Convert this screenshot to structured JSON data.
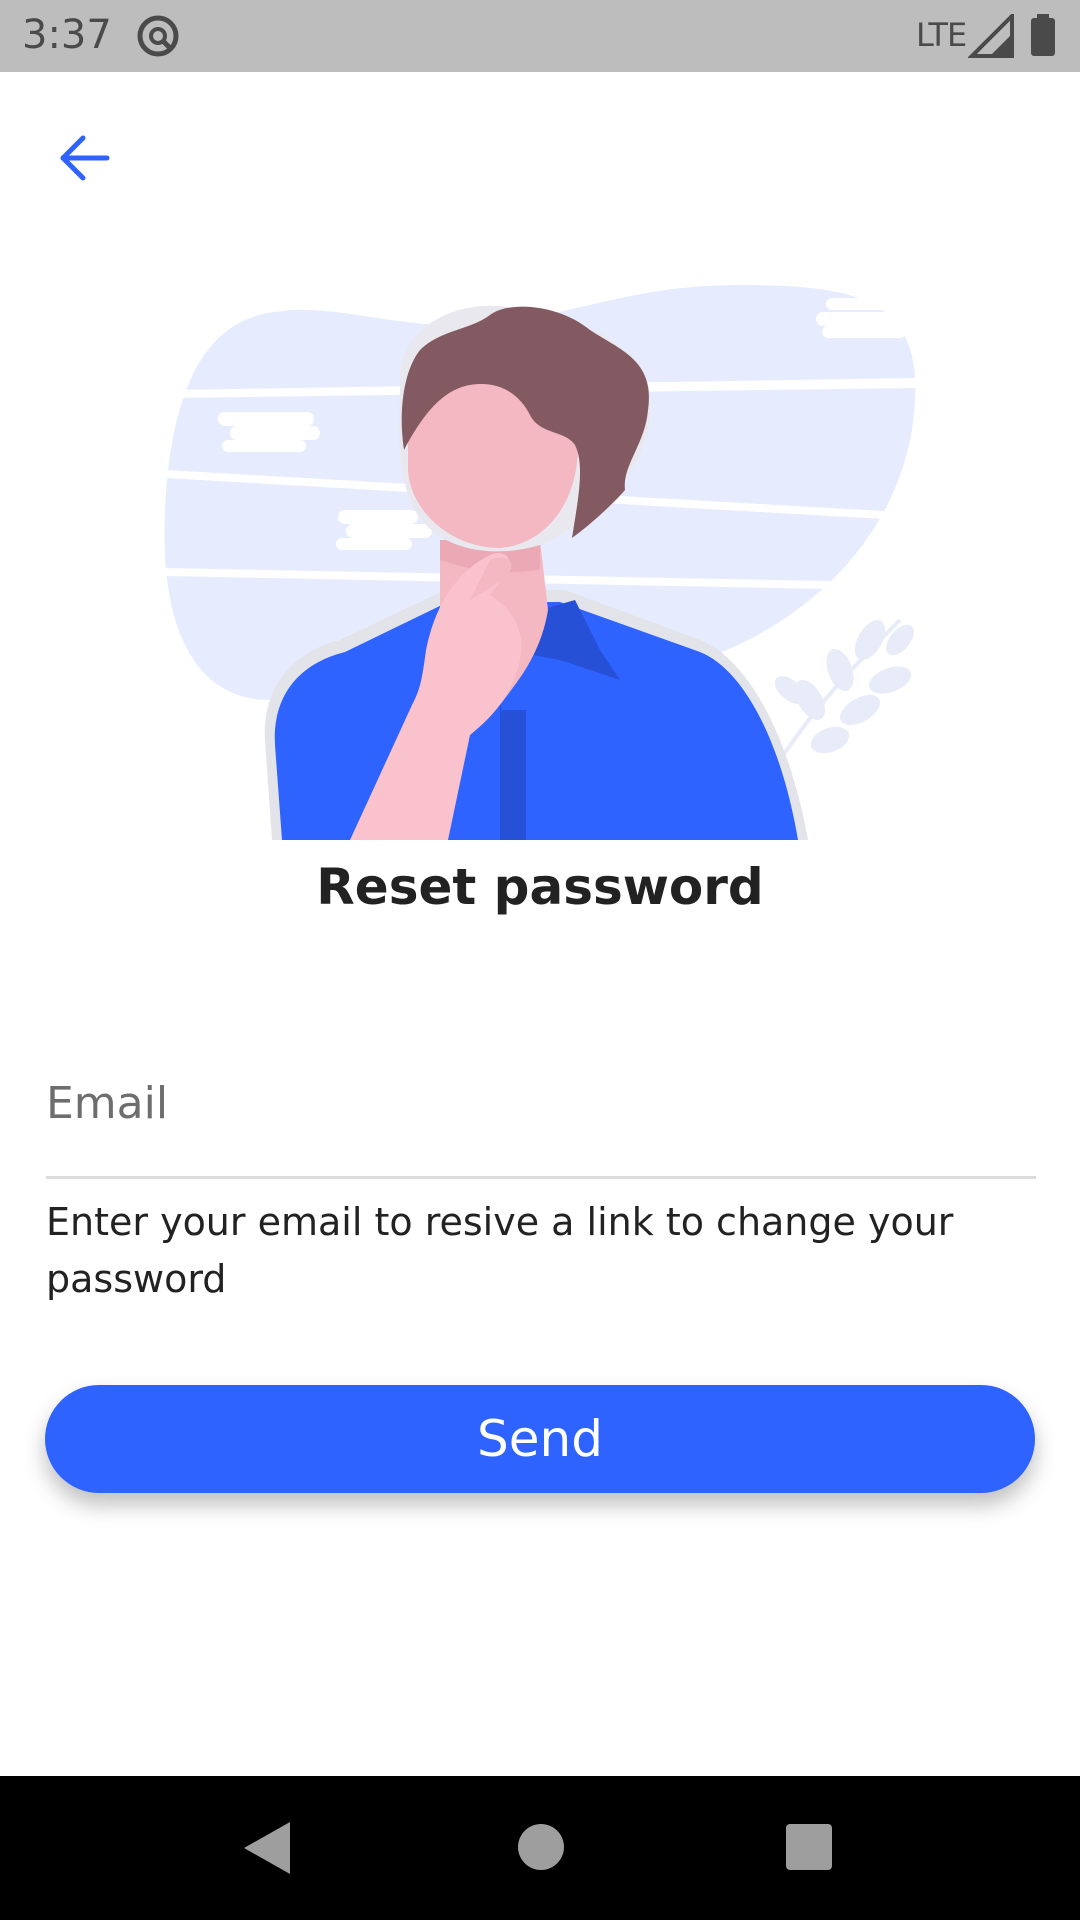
{
  "status_bar": {
    "time": "3:37",
    "network": "LTE",
    "icons": [
      "notification-icon",
      "signal-icon",
      "battery-icon"
    ]
  },
  "header": {
    "back_icon": "arrow-left-icon"
  },
  "main": {
    "title": "Reset password",
    "email_placeholder": "Email",
    "email_value": "",
    "helper_text": "Enter your email to resive a link to change your password",
    "send_label": "Send"
  },
  "nav_bar": {
    "icons": [
      "nav-back-icon",
      "nav-home-icon",
      "nav-recent-icon"
    ]
  },
  "colors": {
    "accent": "#2e63ff",
    "status_bar_bg": "#bdbdbd",
    "nav_bar_bg": "#000000",
    "illustration_bg": "#e6ecfd",
    "hair": "#845a62",
    "skin": "#f4b8c2",
    "shirt": "#2e63ff"
  }
}
